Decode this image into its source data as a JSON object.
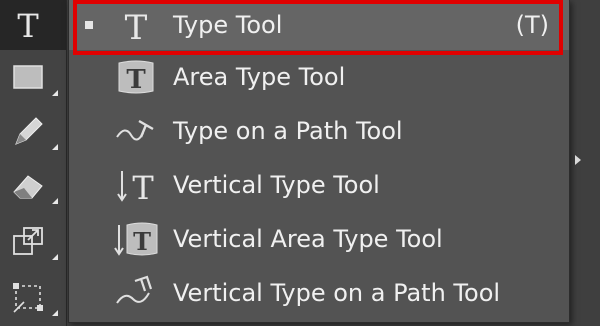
{
  "toolbar": {
    "tools": [
      {
        "name": "type-tool",
        "icon": "type-icon",
        "glyph": "T"
      },
      {
        "name": "rectangle-tool",
        "icon": "rectangle-icon"
      },
      {
        "name": "pencil-tool",
        "icon": "pencil-icon"
      },
      {
        "name": "eraser-tool",
        "icon": "eraser-icon"
      },
      {
        "name": "free-transform-tool",
        "icon": "free-transform-icon"
      },
      {
        "name": "direct-selection-tool",
        "icon": "crop-selection-icon"
      }
    ]
  },
  "flyout": {
    "items": [
      {
        "label": "Type Tool",
        "shortcut": "(T)",
        "icon": "type-tool-icon",
        "glyph": "T",
        "current": true
      },
      {
        "label": "Area Type Tool",
        "shortcut": "",
        "icon": "area-type-tool-icon",
        "glyph": "T"
      },
      {
        "label": "Type on a Path Tool",
        "shortcut": "",
        "icon": "type-on-path-tool-icon"
      },
      {
        "label": "Vertical Type Tool",
        "shortcut": "",
        "icon": "vertical-type-tool-icon",
        "glyph": "T"
      },
      {
        "label": "Vertical Area Type Tool",
        "shortcut": "",
        "icon": "vertical-area-type-tool-icon",
        "glyph": "T"
      },
      {
        "label": "Vertical Type on a Path Tool",
        "shortcut": "",
        "icon": "vertical-type-on-path-tool-icon"
      }
    ]
  },
  "colors": {
    "highlight": "#e00000",
    "menu_bg": "#535353",
    "current_bg": "#656565",
    "text": "#f0f0f0"
  }
}
